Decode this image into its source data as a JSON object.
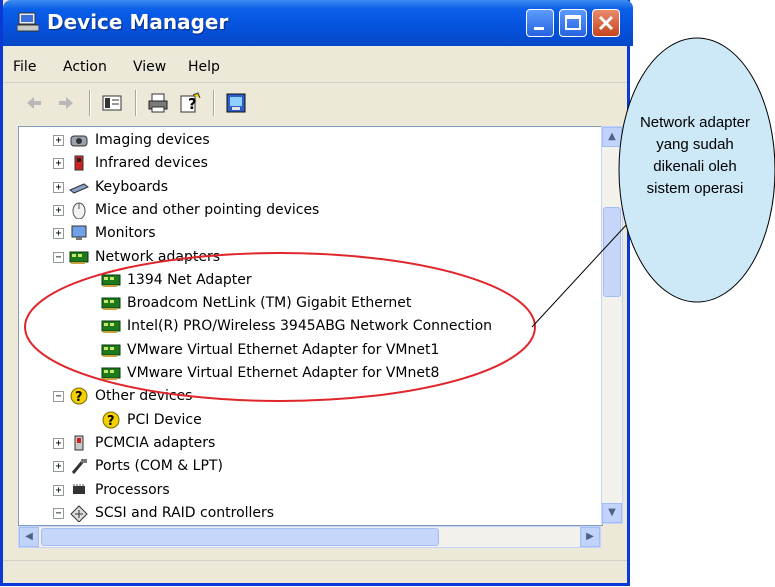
{
  "window": {
    "title": "Device Manager"
  },
  "menu": {
    "file": "File",
    "action": "Action",
    "view": "View",
    "help": "Help"
  },
  "toolbar": {
    "back": "back-arrow",
    "forward": "forward-arrow",
    "properties": "properties",
    "print": "printer",
    "help": "help",
    "scan": "scan-hardware"
  },
  "tree": {
    "items": [
      {
        "label": "Imaging devices",
        "icon": "camera-icon",
        "expander": "+"
      },
      {
        "label": "Infrared devices",
        "icon": "infrared-icon",
        "expander": "+"
      },
      {
        "label": "Keyboards",
        "icon": "keyboard-icon",
        "expander": "+"
      },
      {
        "label": "Mice and other pointing devices",
        "icon": "mouse-icon",
        "expander": "+"
      },
      {
        "label": "Monitors",
        "icon": "monitor-icon",
        "expander": "+"
      },
      {
        "label": "Network adapters",
        "icon": "network-card-icon",
        "expander": "−"
      },
      {
        "label": "1394 Net Adapter",
        "icon": "network-card-icon"
      },
      {
        "label": "Broadcom NetLink (TM) Gigabit Ethernet",
        "icon": "network-card-icon"
      },
      {
        "label": "Intel(R) PRO/Wireless 3945ABG Network Connection",
        "icon": "network-card-icon"
      },
      {
        "label": "VMware Virtual Ethernet Adapter for VMnet1",
        "icon": "network-card-icon"
      },
      {
        "label": "VMware Virtual Ethernet Adapter for VMnet8",
        "icon": "network-card-icon"
      },
      {
        "label": "Other devices",
        "icon": "unknown-device-icon",
        "expander": "−"
      },
      {
        "label": "PCI Device",
        "icon": "unknown-device-icon"
      },
      {
        "label": "PCMCIA adapters",
        "icon": "pcmcia-icon",
        "expander": "+"
      },
      {
        "label": "Ports (COM & LPT)",
        "icon": "port-icon",
        "expander": "+"
      },
      {
        "label": "Processors",
        "icon": "processor-icon",
        "expander": "+"
      },
      {
        "label": "SCSI and RAID controllers",
        "icon": "scsi-icon",
        "expander": "−"
      }
    ]
  },
  "callout": {
    "lines": [
      "Network adapter",
      "yang sudah",
      "dikenali oleh",
      "sistem operasi"
    ]
  },
  "colors": {
    "accent": "#0653de",
    "highlight_ring": "#e0262a",
    "bubble": "#cde8f7"
  }
}
